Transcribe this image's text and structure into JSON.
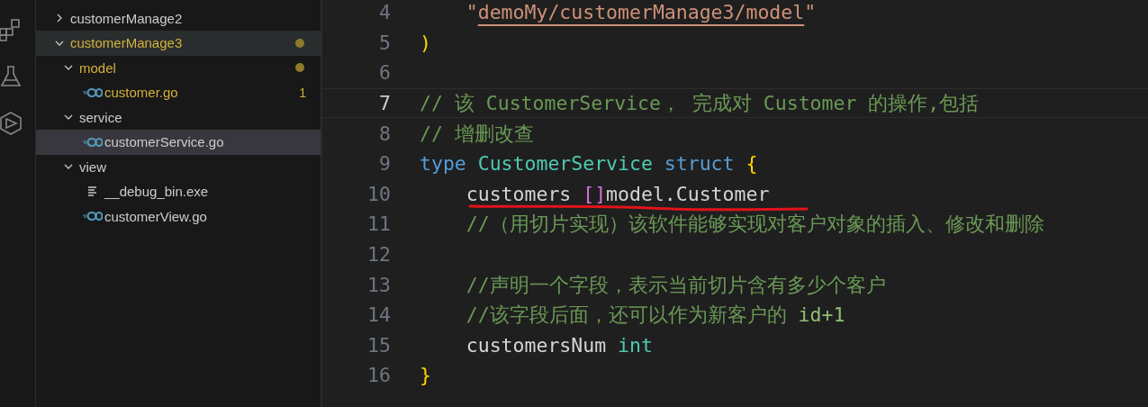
{
  "activity_bar": {
    "items": [
      {
        "kind": "extensions"
      },
      {
        "kind": "testing"
      },
      {
        "kind": "remote"
      }
    ]
  },
  "explorer": {
    "tree": [
      {
        "label": "customerManage2",
        "kind": "folder",
        "expanded": false,
        "modified": false,
        "highlighted": false,
        "selected": false
      },
      {
        "label": "customerManage3",
        "kind": "folder",
        "expanded": true,
        "modified": true,
        "highlighted": true,
        "selected": false,
        "children": [
          {
            "label": "model",
            "kind": "folder",
            "expanded": true,
            "modified": true,
            "highlighted": false,
            "selected": false,
            "children": [
              {
                "label": "customer.go",
                "kind": "go",
                "modified": true,
                "problems": "1",
                "highlighted": false,
                "selected": false
              }
            ]
          },
          {
            "label": "service",
            "kind": "folder",
            "expanded": true,
            "modified": false,
            "highlighted": false,
            "selected": false,
            "children": [
              {
                "label": "customerService.go",
                "kind": "go",
                "modified": false,
                "highlighted": false,
                "selected": true
              }
            ]
          },
          {
            "label": "view",
            "kind": "folder",
            "expanded": true,
            "modified": false,
            "highlighted": false,
            "selected": false,
            "children": [
              {
                "label": "__debug_bin.exe",
                "kind": "text",
                "modified": false,
                "highlighted": false,
                "selected": false
              },
              {
                "label": "customerView.go",
                "kind": "go",
                "modified": false,
                "highlighted": false,
                "selected": false
              }
            ]
          }
        ]
      }
    ]
  },
  "editor": {
    "lines": [
      {
        "number": "4",
        "current": false,
        "tokens": [
          {
            "kind": "string",
            "text": "    \""
          },
          {
            "kind": "link",
            "text": "demoMy/customerManage3/model"
          },
          {
            "kind": "string",
            "text": "\""
          }
        ]
      },
      {
        "number": "5",
        "current": false,
        "tokens": [
          {
            "kind": "bracket1",
            "text": ")"
          }
        ]
      },
      {
        "number": "6",
        "current": false
      },
      {
        "number": "7",
        "current": true,
        "tokens": [
          {
            "kind": "comment",
            "text": "// 该 CustomerService， 完成对 Customer 的操作,包括"
          }
        ]
      },
      {
        "number": "8",
        "current": false,
        "tokens": [
          {
            "kind": "comment",
            "text": "// 增删改查"
          }
        ]
      },
      {
        "number": "9",
        "current": false,
        "tokens": [
          {
            "kind": "keyword",
            "text": "type "
          },
          {
            "kind": "type",
            "text": "CustomerService "
          },
          {
            "kind": "keyword",
            "text": "struct "
          },
          {
            "kind": "bracket1",
            "text": "{"
          }
        ]
      },
      {
        "number": "10",
        "current": false,
        "tokens": [
          {
            "kind": "plain",
            "text": "    customers "
          },
          {
            "kind": "bracket2",
            "text": "[]"
          },
          {
            "kind": "plain",
            "text": "model.Customer"
          }
        ]
      },
      {
        "number": "11",
        "current": false,
        "tokens": [
          {
            "kind": "comment",
            "text": "    //（用切片实现）该软件能够实现对客户对象的插入、修改和删除"
          }
        ]
      },
      {
        "number": "12",
        "current": false
      },
      {
        "number": "13",
        "current": false,
        "tokens": [
          {
            "kind": "comment",
            "text": "    //声明一个字段，表示当前切片含有多少个客户"
          }
        ]
      },
      {
        "number": "14",
        "current": false,
        "tokens": [
          {
            "kind": "comment",
            "text": "    //该字段后面，还可以作为新客户的 "
          },
          {
            "kind": "comment-code",
            "text": "id+1"
          }
        ]
      },
      {
        "number": "15",
        "current": false,
        "tokens": [
          {
            "kind": "plain",
            "text": "    customersNum "
          },
          {
            "kind": "type",
            "text": "int"
          }
        ]
      },
      {
        "number": "16",
        "current": false,
        "tokens": [
          {
            "kind": "bracket1",
            "text": "}"
          }
        ]
      }
    ]
  }
}
